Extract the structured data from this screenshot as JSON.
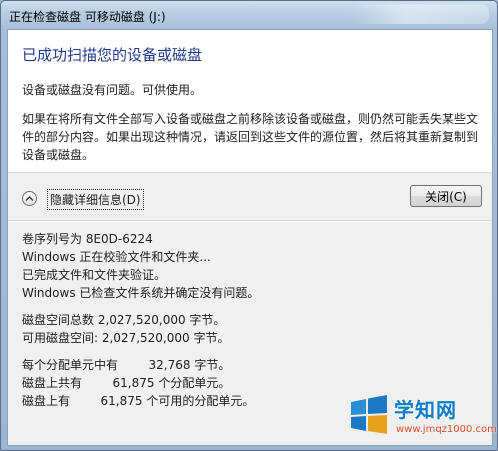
{
  "window": {
    "title": "正在检查磁盘 可移动磁盘 (J:)"
  },
  "summary": {
    "heading": "已成功扫描您的设备或磁盘",
    "status": "设备或磁盘没有问题。可供使用。",
    "warning": "如果在将所有文件全部写入设备或磁盘之前移除该设备或磁盘，则仍然可能丢失某些文件的部分内容。如果出现这种情况，请返回到这些文件的源位置，然后将其重新复制到设备或磁盘。"
  },
  "controls": {
    "details_toggle_label": "隐藏详细信息(D)",
    "close_label": "关闭(C)"
  },
  "details": {
    "group1": [
      "卷序列号为 8E0D-6224",
      "Windows 正在校验文件和文件夹...",
      "已完成文件和文件夹验证。",
      "Windows 已检查文件系统并确定没有问题。"
    ],
    "group2": [
      "磁盘空间总数 2,027,520,000 字节。",
      "可用磁盘空间: 2,027,520,000 字节。"
    ],
    "group3": [
      "每个分配单元中有        32,768 字节。",
      "磁盘上共有        61,875 个分配单元。",
      "磁盘上有        61,875 个可用的分配单元。"
    ]
  },
  "watermark": {
    "title": "学知网",
    "url": "www.jmqz1000.com"
  },
  "colors": {
    "heading": "#1f3b8a",
    "watermark_blue": "#0b7cc5",
    "watermark_red": "#e0492b"
  }
}
